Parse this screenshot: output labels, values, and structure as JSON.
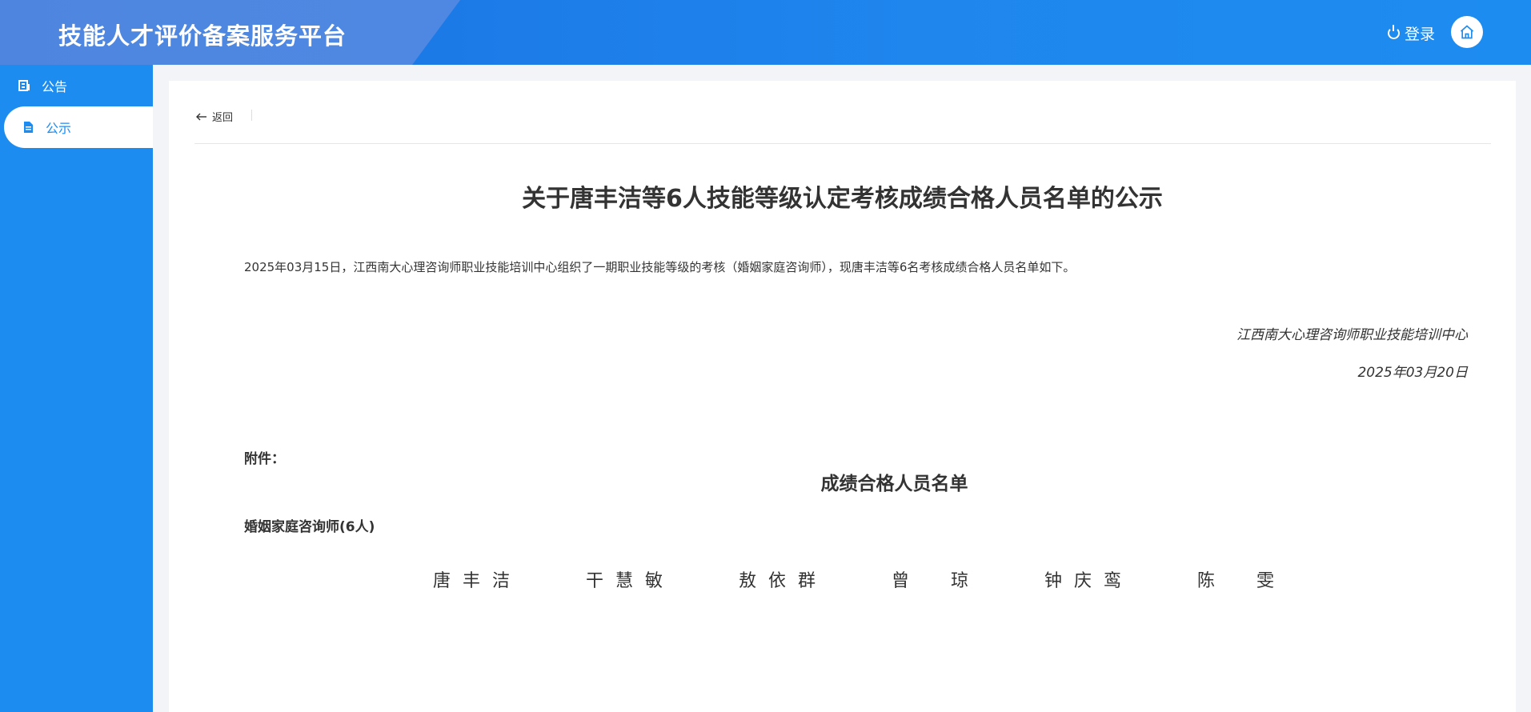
{
  "header": {
    "site_title": "技能人才评价备案服务平台",
    "login_label": "登录"
  },
  "sidebar": {
    "items": [
      {
        "label": "公告",
        "active": false
      },
      {
        "label": "公示",
        "active": true
      }
    ]
  },
  "content": {
    "back_label": "返回",
    "notice_title": "关于唐丰洁等6人技能等级认定考核成绩合格人员名单的公示",
    "intro": "2025年03月15日，江西南大心理咨询师职业技能培训中心组织了一期职业技能等级的考核（婚姻家庭咨询师），现唐丰洁等6名考核成绩合格人员名单如下。",
    "org": "江西南大心理咨询师职业技能培训中心",
    "date": "2025年03月20日",
    "attachment_label": "附件：",
    "list_title": "成绩合格人员名单",
    "category": "婚姻家庭咨询师(6人)",
    "names": [
      "唐丰洁",
      "干慧敏",
      "敖依群",
      "曾　琼",
      "钟庆鸾",
      "陈　雯"
    ]
  },
  "colors": {
    "primary": "#1d8cf0",
    "header_band": "#4e86df"
  }
}
